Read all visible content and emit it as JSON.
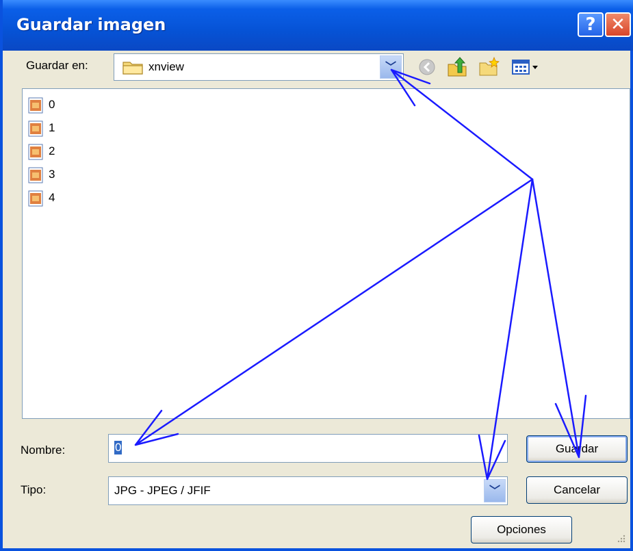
{
  "window": {
    "title": "Guardar imagen",
    "help_glyph": "?",
    "close_glyph": "✕"
  },
  "location": {
    "label": "Guardar en:",
    "value": "xnview"
  },
  "toolbar": {
    "icons": [
      "back-icon",
      "up-folder-icon",
      "new-folder-icon",
      "view-menu-icon"
    ]
  },
  "files": [
    {
      "name": "0"
    },
    {
      "name": "1"
    },
    {
      "name": "2"
    },
    {
      "name": "3"
    },
    {
      "name": "4"
    }
  ],
  "filename": {
    "label": "Nombre:",
    "value": "0"
  },
  "filetype": {
    "label": "Tipo:",
    "value": "JPG - JPEG / JFIF"
  },
  "buttons": {
    "save": "Guardar",
    "cancel": "Cancelar",
    "options": "Opciones"
  },
  "colors": {
    "annotation": "#1a1aff",
    "titlebar": "#0653d6",
    "dialog_bg": "#ece9d8"
  }
}
